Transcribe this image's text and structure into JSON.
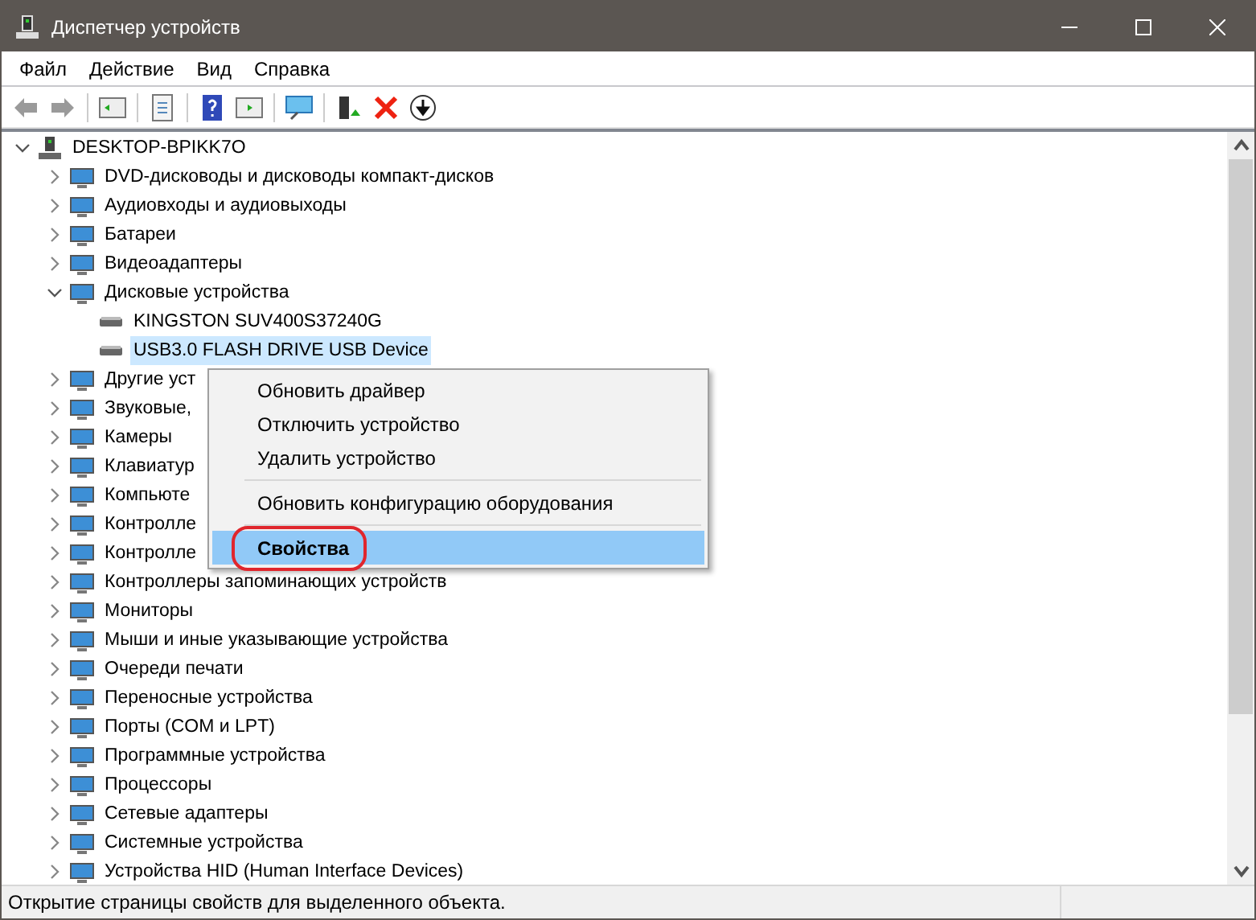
{
  "window": {
    "title": "Диспетчер устройств"
  },
  "menu_bar": [
    "Файл",
    "Действие",
    "Вид",
    "Справка"
  ],
  "tree": {
    "label": "DESKTOP-BPIKK7O",
    "expanded": true,
    "selected": false,
    "children": [
      {
        "label": "DVD-дисководы и дисководы компакт-дисков",
        "expanded": false,
        "selected": false
      },
      {
        "label": "Аудиовходы и аудиовыходы",
        "expanded": false,
        "selected": false
      },
      {
        "label": "Батареи",
        "expanded": false,
        "selected": false
      },
      {
        "label": "Видеоадаптеры",
        "expanded": false,
        "selected": false
      },
      {
        "label": "Дисковые устройства",
        "expanded": true,
        "selected": false,
        "children": [
          {
            "label": "KINGSTON SUV400S37240G",
            "selected": false
          },
          {
            "label": "USB3.0 FLASH DRIVE USB Device",
            "selected": true
          }
        ]
      },
      {
        "label": "Другие уст",
        "expanded": false,
        "selected": false
      },
      {
        "label": "Звуковые,",
        "expanded": false,
        "selected": false
      },
      {
        "label": "Камеры",
        "expanded": false,
        "selected": false
      },
      {
        "label": "Клавиатур",
        "expanded": false,
        "selected": false
      },
      {
        "label": "Компьюте",
        "expanded": false,
        "selected": false
      },
      {
        "label": "Контролле",
        "expanded": false,
        "selected": false
      },
      {
        "label": "Контролле",
        "expanded": false,
        "selected": false
      },
      {
        "label": "Контроллеры запоминающих устройств",
        "expanded": false,
        "selected": false
      },
      {
        "label": "Мониторы",
        "expanded": false,
        "selected": false
      },
      {
        "label": "Мыши и иные указывающие устройства",
        "expanded": false,
        "selected": false
      },
      {
        "label": "Очереди печати",
        "expanded": false,
        "selected": false
      },
      {
        "label": "Переносные устройства",
        "expanded": false,
        "selected": false
      },
      {
        "label": "Порты (COM и LPT)",
        "expanded": false,
        "selected": false
      },
      {
        "label": "Программные устройства",
        "expanded": false,
        "selected": false
      },
      {
        "label": "Процессоры",
        "expanded": false,
        "selected": false
      },
      {
        "label": "Сетевые адаптеры",
        "expanded": false,
        "selected": false
      },
      {
        "label": "Системные устройства",
        "expanded": false,
        "selected": false
      },
      {
        "label": "Устройства HID (Human Interface Devices)",
        "expanded": false,
        "selected": false
      }
    ]
  },
  "context_menu": {
    "groups": [
      [
        {
          "label": "Обновить драйвер",
          "selected": false,
          "default": false
        },
        {
          "label": "Отключить устройство",
          "selected": false,
          "default": false
        },
        {
          "label": "Удалить устройство",
          "selected": false,
          "default": false
        }
      ],
      [
        {
          "label": "Обновить конфигурацию оборудования",
          "selected": false,
          "default": false
        }
      ],
      [
        {
          "label": "Свойства",
          "selected": true,
          "default": true
        }
      ]
    ]
  },
  "status_bar": "Открытие страницы свойств для выделенного объекта."
}
